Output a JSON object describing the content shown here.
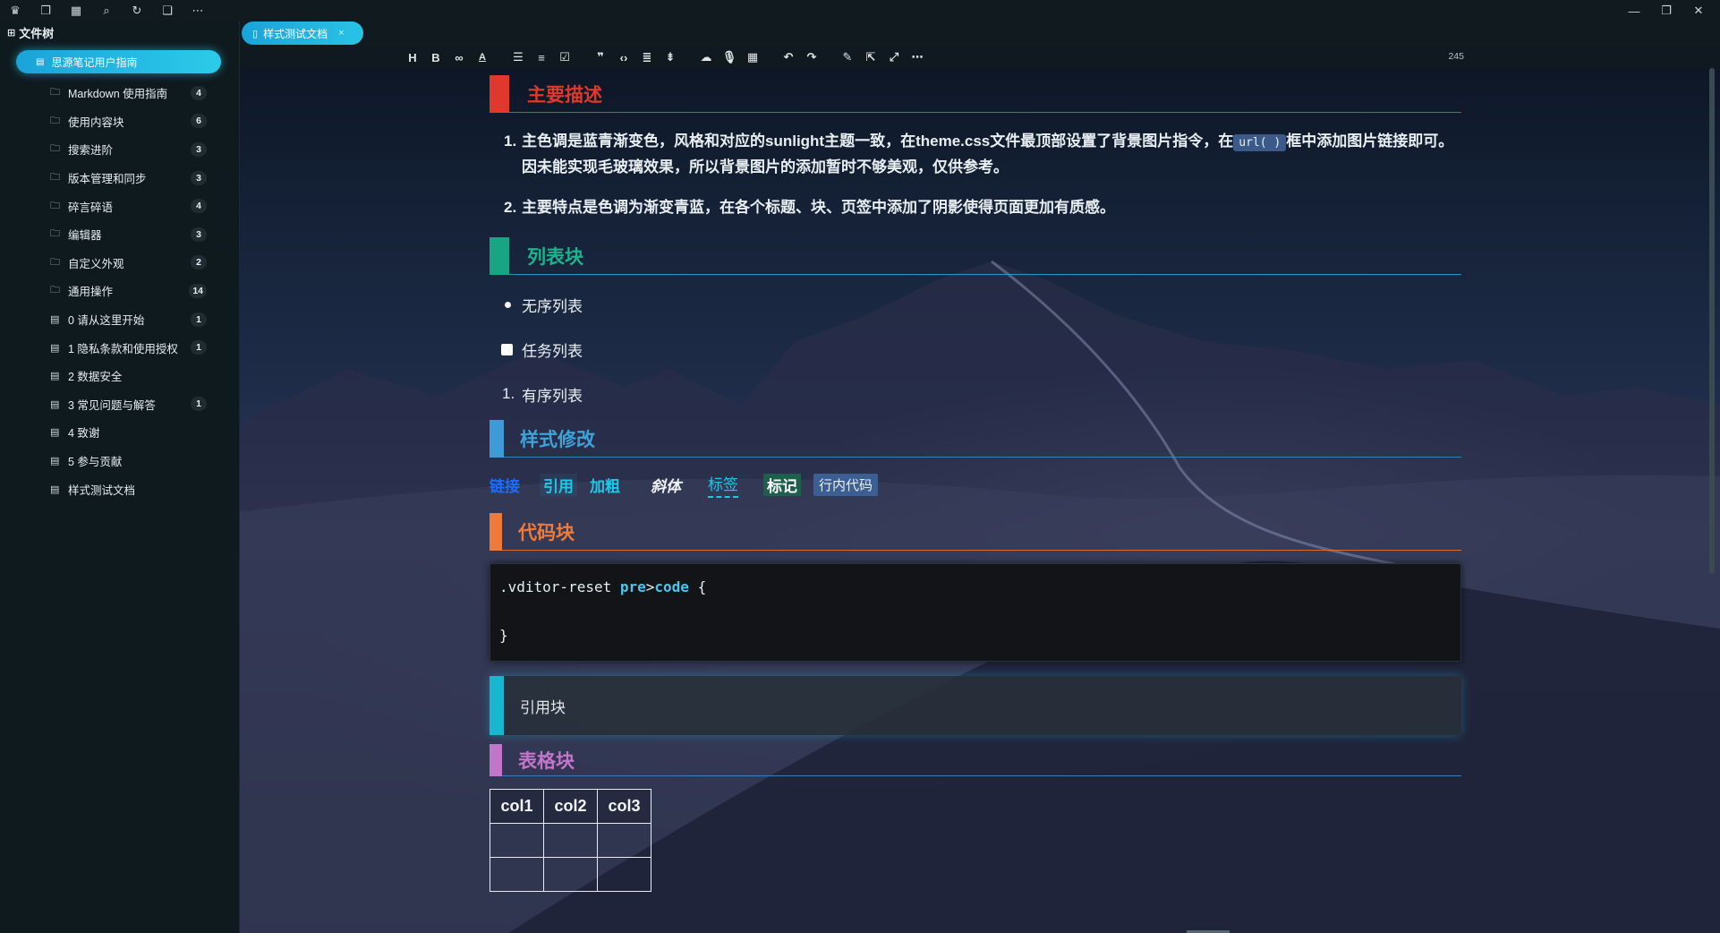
{
  "titlebar": {
    "icons": [
      "crown-icon",
      "copy-icon",
      "calendar-icon",
      "search-icon",
      "sync-icon",
      "window-icon",
      "more-icon"
    ]
  },
  "sidebar": {
    "header": "文件树",
    "root": "思源笔记用户指南",
    "items": [
      {
        "type": "folder",
        "label": "Markdown 使用指南",
        "count": "4"
      },
      {
        "type": "folder",
        "label": "使用内容块",
        "count": "6"
      },
      {
        "type": "folder",
        "label": "搜索进阶",
        "count": "3"
      },
      {
        "type": "folder",
        "label": "版本管理和同步",
        "count": "3"
      },
      {
        "type": "folder",
        "label": "碎言碎语",
        "count": "4"
      },
      {
        "type": "folder",
        "label": "编辑器",
        "count": "3"
      },
      {
        "type": "folder",
        "label": "自定义外观",
        "count": "2"
      },
      {
        "type": "folder",
        "label": "通用操作",
        "count": "14"
      },
      {
        "type": "doc",
        "label": "0 请从这里开始",
        "count": "1"
      },
      {
        "type": "doc",
        "label": "1 隐私条款和使用授权",
        "count": "1"
      },
      {
        "type": "doc",
        "label": "2 数据安全",
        "count": ""
      },
      {
        "type": "doc",
        "label": "3 常见问题与解答",
        "count": "1"
      },
      {
        "type": "doc",
        "label": "4 致谢",
        "count": ""
      },
      {
        "type": "doc",
        "label": "5 参与贡献",
        "count": ""
      },
      {
        "type": "doc",
        "label": "样式测试文档",
        "count": ""
      }
    ]
  },
  "tab": {
    "label": "样式测试文档",
    "close": "×"
  },
  "toolbar": {
    "word_count": "245"
  },
  "doc": {
    "h_main": "主要描述",
    "p1_a": "主色调是蓝青渐变色，风格和对应的sunlight主题一致，在theme.css文件最顶部设置了背景图片指令，在",
    "p1_code": "url( )",
    "p1_b": "框中添加图片链接即可。因未能实现毛玻璃效果，所以背景图片的添加暂时不够美观，仅供参考。",
    "p2": "主要特点是色调为渐变青蓝，在各个标题、块、页签中添加了阴影使得页面更加有质感。",
    "num1": "1.",
    "num2": "2.",
    "h_list": "列表块",
    "ul": "无序列表",
    "task": "任务列表",
    "ol_num": "1.",
    "ol": "有序列表",
    "h_style": "样式修改",
    "s_link": "链接",
    "s_ref": "引用",
    "s_bold": "加粗",
    "s_italic": "斜体",
    "s_tag": "标签",
    "s_mark": "标记",
    "s_code": "行内代码",
    "h_code": "代码块",
    "code_l1_a": ".vditor-reset ",
    "code_l1_kw1": "pre",
    "code_l1_gt": ">",
    "code_l1_kw2": "code",
    "code_l1_b": " {",
    "code_l3": "}",
    "quote": "引用块",
    "h_table": "表格块",
    "table_headers": [
      "col1",
      "col2",
      "col3"
    ]
  },
  "colors": {
    "accent": "#1aa3d9",
    "accent2": "#2ccbe9",
    "h_red": "#e0382c",
    "h_green": "#19b58c",
    "h_blue": "#3fa3d8",
    "h_orange": "#f07a3a",
    "h_purple": "#c276c9"
  }
}
